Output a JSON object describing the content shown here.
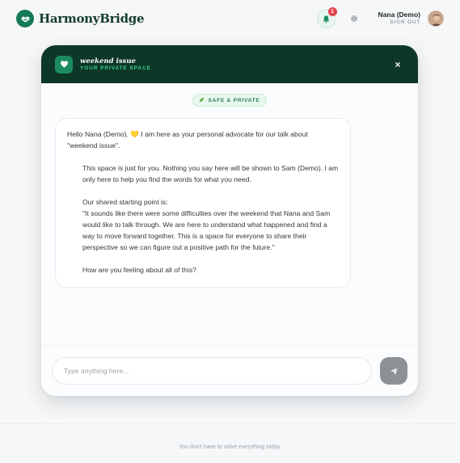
{
  "app": {
    "brand": "HarmonyBridge",
    "notification_count": "1",
    "user_name": "Nana (Demo)",
    "sign_out_label": "SIGN OUT"
  },
  "icons": {
    "logo": "handshake-icon",
    "bell": "bell-icon",
    "gear": "gear-icon",
    "header": "heart-icon",
    "close": "close-icon",
    "leaf": "leaf-icon",
    "send": "send-icon"
  },
  "colors": {
    "brand_green": "#147a57",
    "header_dark": "#0d3727",
    "accent_mint": "#3ccf92",
    "badge_red": "#e0424b",
    "send_gray": "#8c9196"
  },
  "session": {
    "title": "weekend issue",
    "subtitle": "YOUR PRIVATE SPACE",
    "close_label": "×",
    "safe_badge": "SAFE & PRIVATE"
  },
  "message": {
    "line1_prefix": "Hello Nana (Demo). ",
    "line1_emoji": "💛",
    "line1_suffix": " I am here as your personal advocate for our talk about \"weekend issue\".",
    "para2": "This space is just for you. Nothing you say here will be shown to Sam (Demo). I am only here to help you find the words for what you need.",
    "para3_label": "Our shared starting point is:",
    "para3_quote": "\"It sounds like there were some difficulties over the weekend that Nana and Sam would like to talk through. We are here to understand what happened and find a way to move forward together. This is a space for everyone to share their perspective so we can figure out a positive path for the future.\"",
    "para4": "How are you feeling about all of this?"
  },
  "composer": {
    "placeholder": "Type anything here..."
  },
  "footer": {
    "text": "You don't have to solve everything today."
  }
}
